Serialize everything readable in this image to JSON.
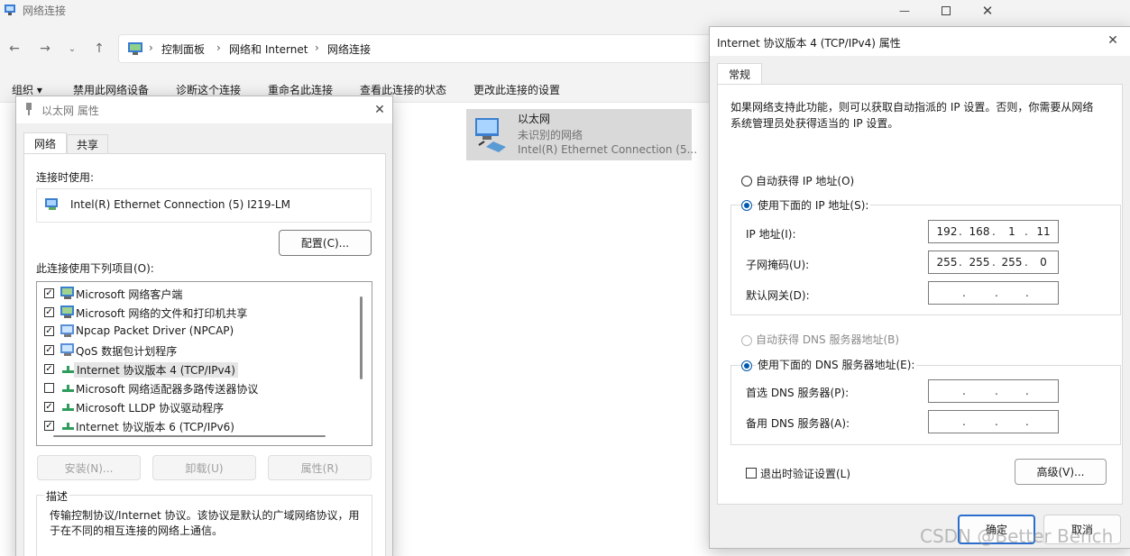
{
  "explorer": {
    "title": "网络连接",
    "breadcrumbs": [
      "控制面板",
      "网络和 Internet",
      "网络连接"
    ],
    "commands": [
      "组织 ▾",
      "禁用此网络设备",
      "诊断这个连接",
      "重命名此连接",
      "查看此连接的状态",
      "更改此连接的设置"
    ],
    "connection": {
      "name": "以太网",
      "status": "未识别的网络",
      "adapter": "Intel(R) Ethernet Connection (5..."
    }
  },
  "eth_dialog": {
    "title": "以太网 属性",
    "tabs": [
      "网络",
      "共享"
    ],
    "connect_using_label": "连接时使用:",
    "adapter_name": "Intel(R) Ethernet Connection (5) I219-LM",
    "configure_button": "配置(C)...",
    "items_label": "此连接使用下列项目(O):",
    "items": [
      {
        "label": "Microsoft 网络客户端",
        "checked": true
      },
      {
        "label": "Microsoft 网络的文件和打印机共享",
        "checked": true
      },
      {
        "label": "Npcap Packet Driver (NPCAP)",
        "checked": true
      },
      {
        "label": "QoS 数据包计划程序",
        "checked": true
      },
      {
        "label": "Internet 协议版本 4 (TCP/IPv4)",
        "checked": true,
        "selected": true
      },
      {
        "label": "Microsoft 网络适配器多路传送器协议",
        "checked": false
      },
      {
        "label": "Microsoft LLDP 协议驱动程序",
        "checked": true
      },
      {
        "label": "Internet 协议版本 6 (TCP/IPv6)",
        "checked": true
      }
    ],
    "install_button": "安装(N)...",
    "uninstall_button": "卸载(U)",
    "properties_button": "属性(R)",
    "description_label": "描述",
    "description_text": "传输控制协议/Internet 协议。该协议是默认的广域网络协议，用于在不同的相互连接的网络上通信。"
  },
  "ipv4_dialog": {
    "title": "Internet 协议版本 4 (TCP/IPv4) 属性",
    "tab": "常规",
    "intro": "如果网络支持此功能，则可以获取自动指派的 IP 设置。否则，你需要从网络系统管理员处获得适当的 IP 设置。",
    "auto_ip": "自动获得 IP 地址(O)",
    "manual_ip": "使用下面的 IP 地址(S):",
    "ip_label": "IP 地址(I):",
    "ip_octets": [
      "192",
      "168",
      "1",
      "11"
    ],
    "mask_label": "子网掩码(U):",
    "mask_octets": [
      "255",
      "255",
      "255",
      "0"
    ],
    "gateway_label": "默认网关(D):",
    "auto_dns": "自动获得 DNS 服务器地址(B)",
    "manual_dns": "使用下面的 DNS 服务器地址(E):",
    "dns1_label": "首选 DNS 服务器(P):",
    "dns2_label": "备用 DNS 服务器(A):",
    "validate_label": "退出时验证设置(L)",
    "advanced_button": "高级(V)...",
    "ok_button": "确定",
    "cancel_button": "取消"
  },
  "watermark": "CSDN @Better Bench",
  "colors": {
    "accent": "#0058b0",
    "selected_row": "#cce8ff",
    "titlebar": "#f3f3f3"
  }
}
